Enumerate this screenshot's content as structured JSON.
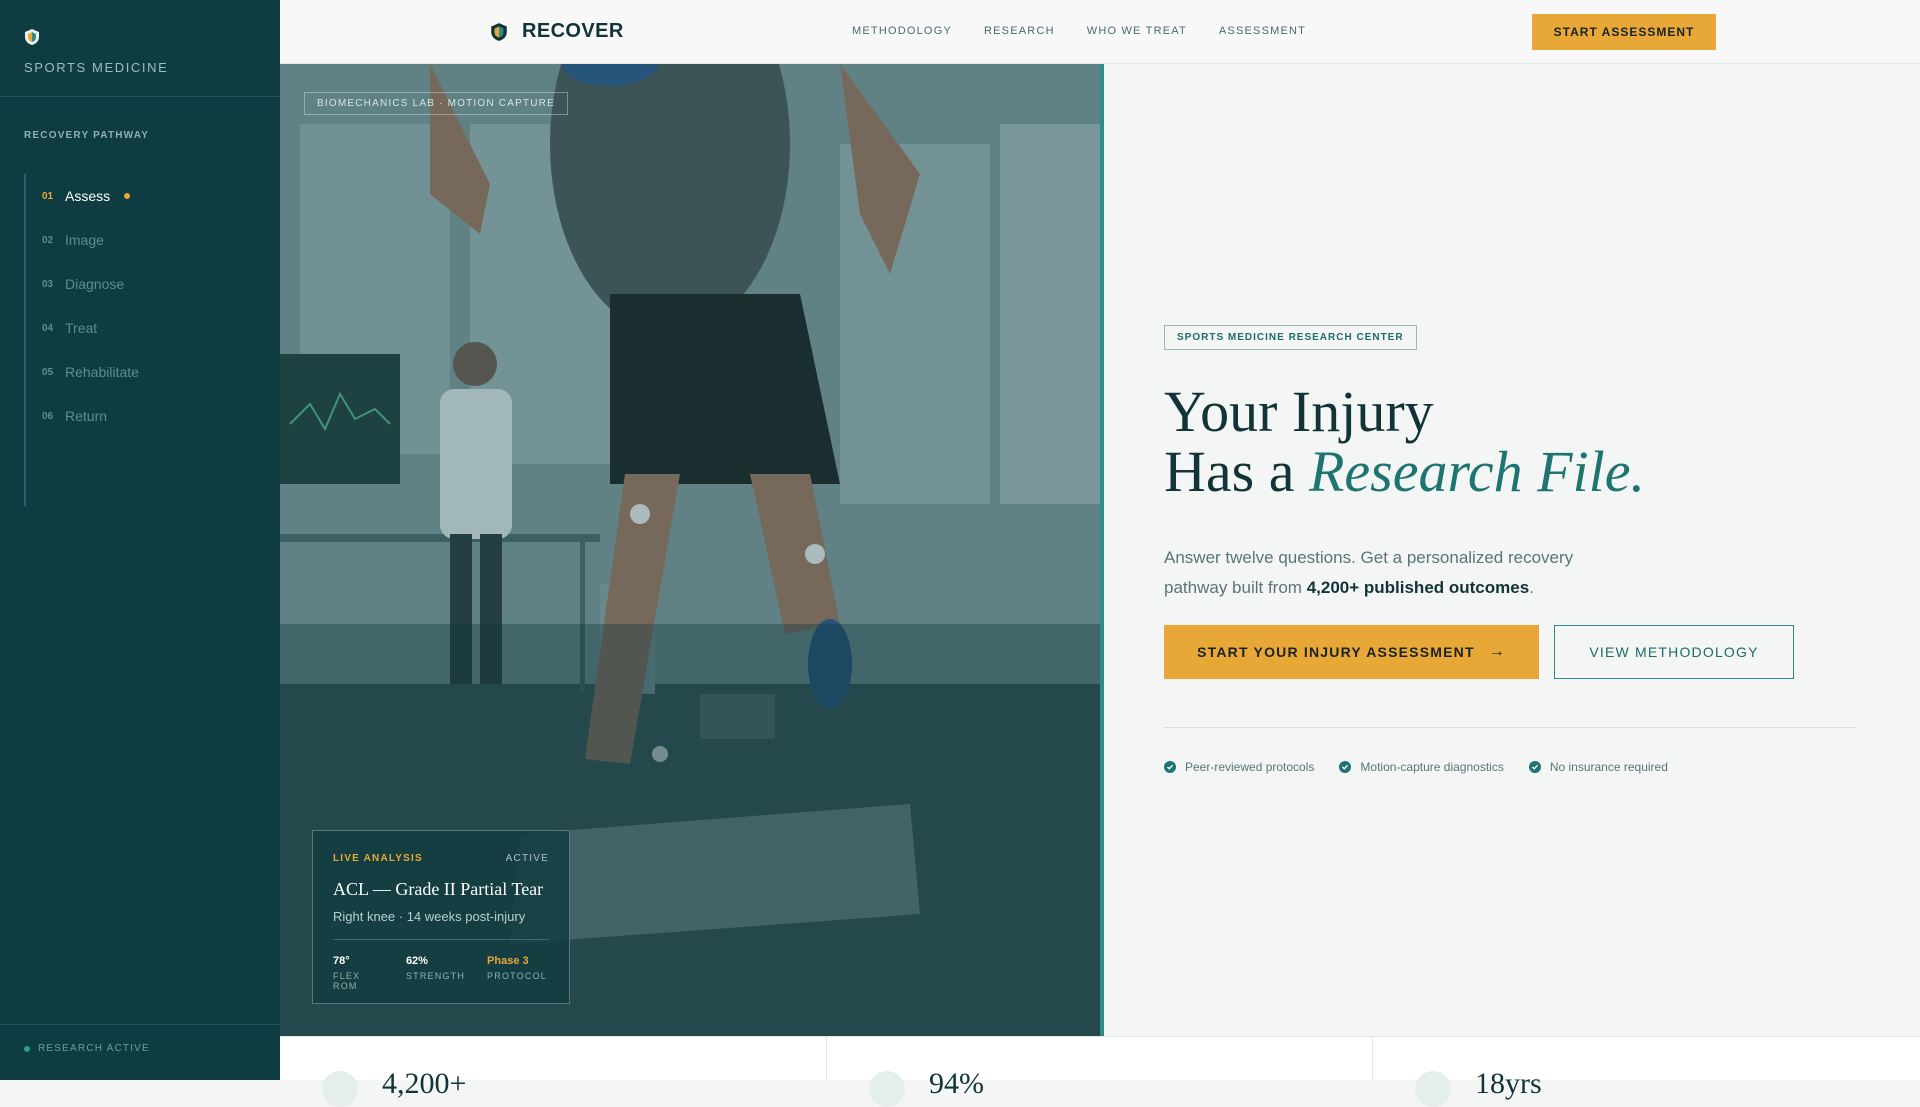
{
  "sidebar": {
    "brand_label": "SPORTS MEDICINE",
    "section_title": "RECOVERY PATHWAY",
    "steps": [
      {
        "num": "01",
        "label": "Assess",
        "active": true
      },
      {
        "num": "02",
        "label": "Image"
      },
      {
        "num": "03",
        "label": "Diagnose"
      },
      {
        "num": "04",
        "label": "Treat"
      },
      {
        "num": "05",
        "label": "Rehabilitate"
      },
      {
        "num": "06",
        "label": "Return"
      }
    ],
    "footer_status": "RESEARCH ACTIVE"
  },
  "topbar": {
    "brand_name": "RECOVER",
    "nav": [
      "METHODOLOGY",
      "RESEARCH",
      "WHO WE TREAT",
      "ASSESSMENT"
    ],
    "cta_label": "START ASSESSMENT"
  },
  "hero_image": {
    "tag": "BIOMECHANICS LAB · MOTION CAPTURE",
    "card": {
      "label": "LIVE ANALYSIS",
      "status": "ACTIVE",
      "title": "ACL — Grade II Partial Tear",
      "subtitle": "Right knee · 14 weeks post-injury",
      "metrics": [
        {
          "value": "78°",
          "label": "FLEX ROM"
        },
        {
          "value": "62%",
          "label": "STRENGTH"
        },
        {
          "value": "Phase 3",
          "label": "PROTOCOL"
        }
      ]
    }
  },
  "hero": {
    "badge": "SPORTS MEDICINE RESEARCH CENTER",
    "headline_line1": "Your Injury",
    "headline_line2_prefix": "Has a ",
    "headline_line2_em": "Research File.",
    "lead_text": "Answer twelve questions. Get a personalized recovery pathway built from ",
    "lead_strong": "4,200+ published outcomes",
    "lead_end": ".",
    "primary_button": "START YOUR INJURY ASSESSMENT",
    "primary_button_arrow": "→",
    "secondary_button": "VIEW METHODOLOGY",
    "trust_items": [
      "Peer-reviewed protocols",
      "Motion-capture diagnostics",
      "No insurance required"
    ]
  },
  "stats": [
    {
      "value": "4,200+"
    },
    {
      "value": "94%"
    },
    {
      "value": "18yrs"
    }
  ],
  "colors": {
    "sidebar_bg": "#0e3c40",
    "accent_gold": "#e8a838",
    "accent_teal": "#1e7470",
    "page_bg": "#f4f6f5"
  }
}
